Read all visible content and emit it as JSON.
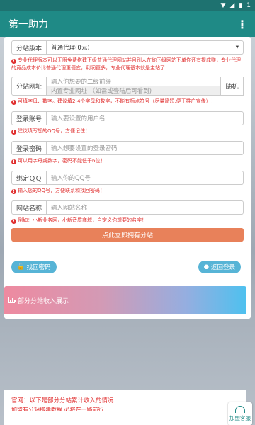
{
  "status": {
    "wifi": "▼",
    "signal": "◢",
    "battery": "▮",
    "time": "1"
  },
  "app": {
    "title": "第一助力",
    "menu_icon": "⋮"
  },
  "form": {
    "version_label": "分站版本",
    "version_value": "普通代理(0元)",
    "version_note": "专业代理版本可以无限免费搭建下级普通代理网站并且别人在你下级网站下单你还有提成赚，专业代理的竞品成本价比普通代理更便宜，利润更多，专业代理基本就是主站了",
    "url_label": "分站网址",
    "url_placeholder": "输入你想要的二级前缀",
    "domain_placeholder": "内置专业网址 （如需或登陆后可看到)",
    "random_label": "随机",
    "url_note": "可填字母、数字。建议填2-4个字母和数字，不能有标点符号（尽量简短,便于推广宣传）！",
    "account_label": "登录账号",
    "account_placeholder": "输入要设置的用户名",
    "account_note": "建议填写您的QQ号，方便记住！",
    "password_label": "登录密码",
    "password_placeholder": "输入想要设置的登录密码",
    "password_note": "可以用字母或数字，密码不能低于6位！",
    "qq_label": "绑定ＱＱ",
    "qq_placeholder": "输入你的QQ号",
    "qq_note": "输入您的QQ号，方便联系和找回密码！",
    "sitename_label": "网站名称",
    "sitename_placeholder": "输入网站名称",
    "sitename_note": "例如：小新业务网，小新音质商城，自定义你想要的名字！",
    "submit_label": "点此立即拥有分站"
  },
  "actions": {
    "find_password": "找回密码",
    "back_login": "返回登录"
  },
  "showcase": {
    "title": "部分分站收入展示"
  },
  "footer": {
    "line1": "官网：以下是部分分站累计收入的情况",
    "line2": "加盟有分站搭建教程 必将在一路前行"
  },
  "support": {
    "label": "加盟客服"
  }
}
